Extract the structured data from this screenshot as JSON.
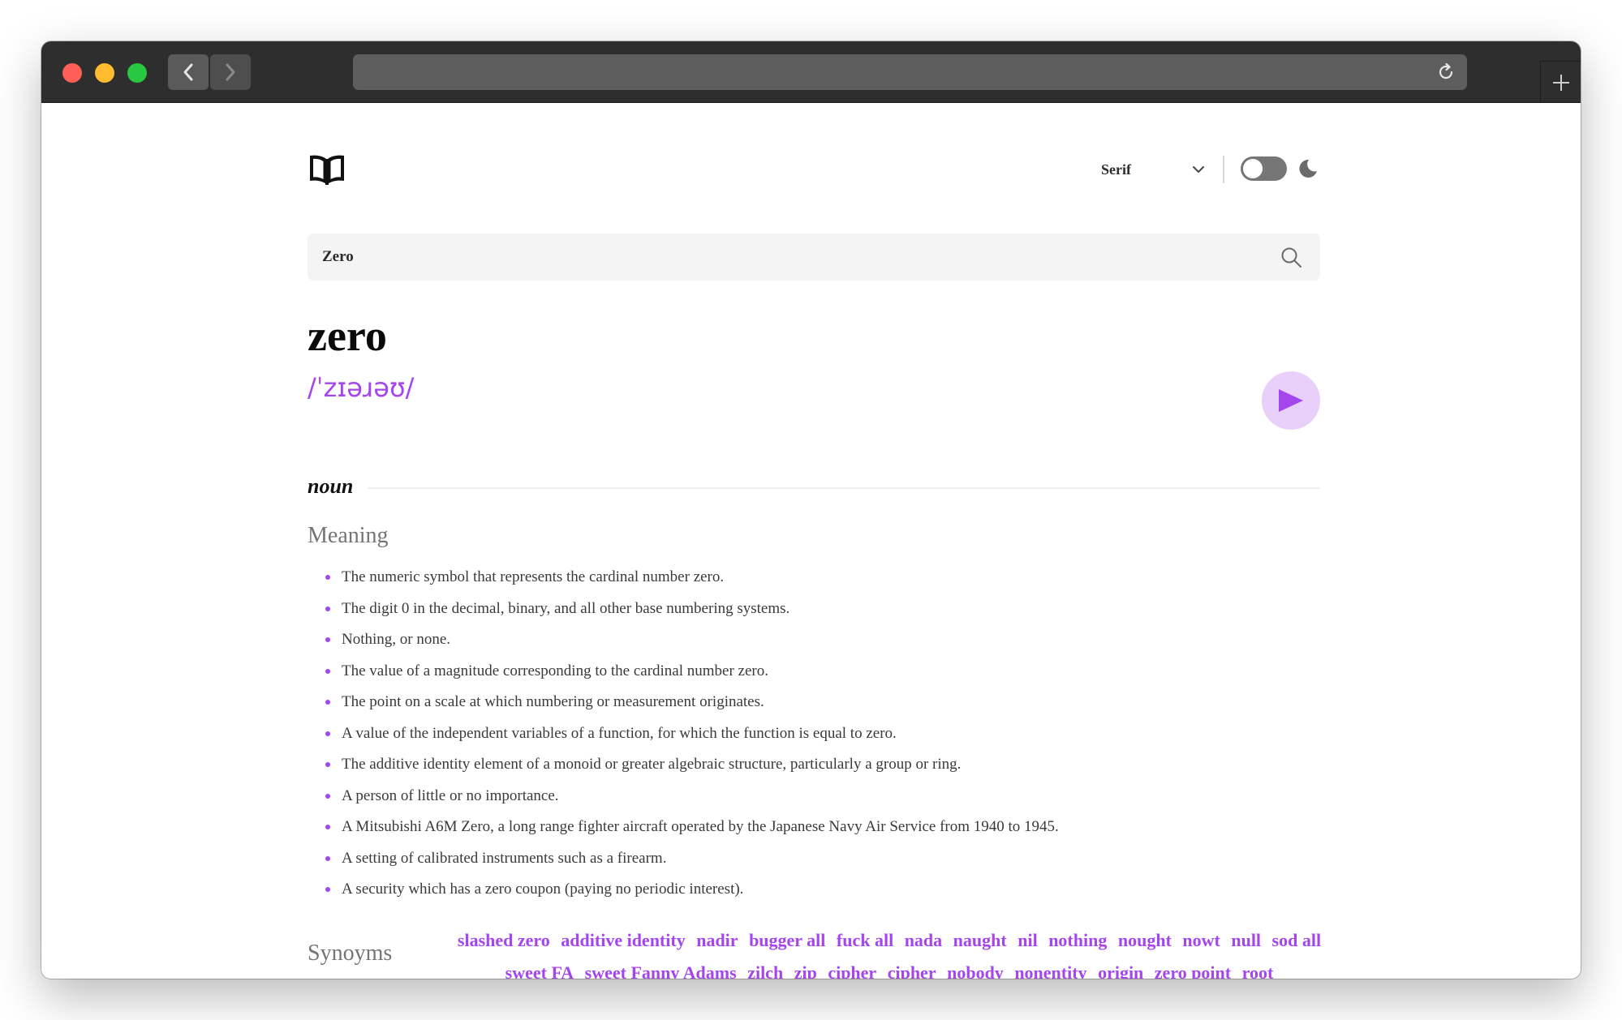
{
  "browser": {
    "url": ""
  },
  "header": {
    "font_select_value": "Serif"
  },
  "search": {
    "value": "Zero"
  },
  "entry": {
    "word": "zero",
    "phonetic": "/ˈzɪəɹəʊ/",
    "part_of_speech": "noun",
    "meaning_title": "Meaning",
    "meanings": [
      "The numeric symbol that represents the cardinal number zero.",
      "The digit 0 in the decimal, binary, and all other base numbering systems.",
      "Nothing, or none.",
      "The value of a magnitude corresponding to the cardinal number zero.",
      "The point on a scale at which numbering or measurement originates.",
      "A value of the independent variables of a function, for which the function is equal to zero.",
      "The additive identity element of a monoid or greater algebraic structure, particularly a group or ring.",
      "A person of little or no importance.",
      "A Mitsubishi A6M Zero, a long range fighter aircraft operated by the Japanese Navy Air Service from 1940 to 1945.",
      "A setting of calibrated instruments such as a firearm.",
      "A security which has a zero coupon (paying no periodic interest)."
    ],
    "synonyms_title": "Synoyms",
    "synonyms": [
      "slashed zero",
      "additive identity",
      "nadir",
      "bugger all",
      "fuck all",
      "nada",
      "naught",
      "nil",
      "nothing",
      "nought",
      "nowt",
      "null",
      "sod all",
      "sweet FA",
      "sweet Fanny Adams",
      "zilch",
      "zip",
      "cipher",
      "cipher",
      "nobody",
      "nonentity",
      "origin",
      "zero point",
      "root"
    ]
  },
  "colors": {
    "accent": "#a445ed",
    "play_bg": "#e9d0fa",
    "search_bg": "#f4f4f4",
    "muted_text": "#757575"
  },
  "icons": [
    "book-logo-icon",
    "chevron-down-icon",
    "moon-icon",
    "search-icon",
    "play-icon",
    "back-arrow-icon",
    "forward-arrow-icon",
    "reload-icon",
    "plus-icon"
  ]
}
